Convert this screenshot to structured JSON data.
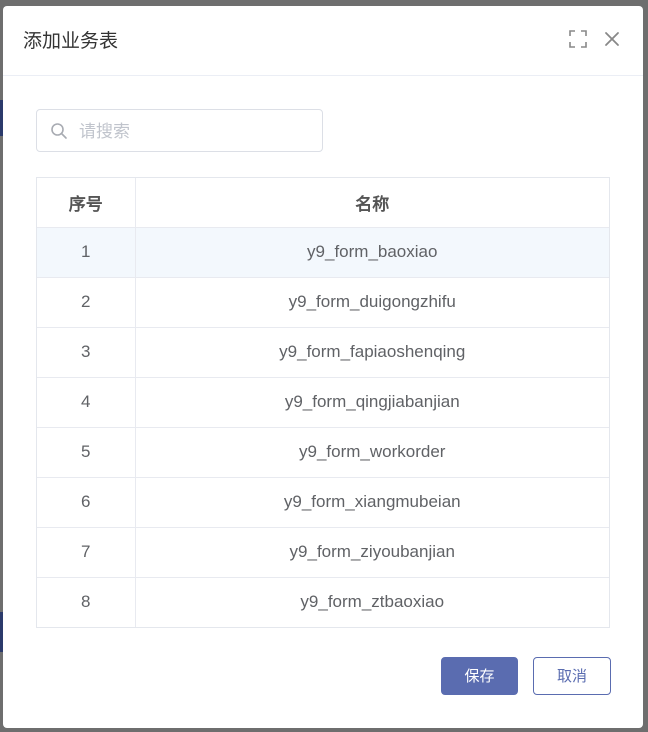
{
  "dialog": {
    "title": "添加业务表"
  },
  "search": {
    "placeholder": "请搜索",
    "value": ""
  },
  "table": {
    "headers": [
      "序号",
      "名称"
    ],
    "rows": [
      {
        "index": "1",
        "name": "y9_form_baoxiao"
      },
      {
        "index": "2",
        "name": "y9_form_duigongzhifu"
      },
      {
        "index": "3",
        "name": "y9_form_fapiaoshenqing"
      },
      {
        "index": "4",
        "name": "y9_form_qingjiabanjian"
      },
      {
        "index": "5",
        "name": "y9_form_workorder"
      },
      {
        "index": "6",
        "name": "y9_form_xiangmubeian"
      },
      {
        "index": "7",
        "name": "y9_form_ziyoubanjian"
      },
      {
        "index": "8",
        "name": "y9_form_ztbaoxiao"
      }
    ]
  },
  "footer": {
    "save_label": "保存",
    "cancel_label": "取消"
  },
  "icons": {
    "fullscreen": "fullscreen-icon",
    "close": "close-icon",
    "search": "search-icon"
  },
  "colors": {
    "primary": "#5a6cb0",
    "row_highlight": "#f3f8fd"
  }
}
